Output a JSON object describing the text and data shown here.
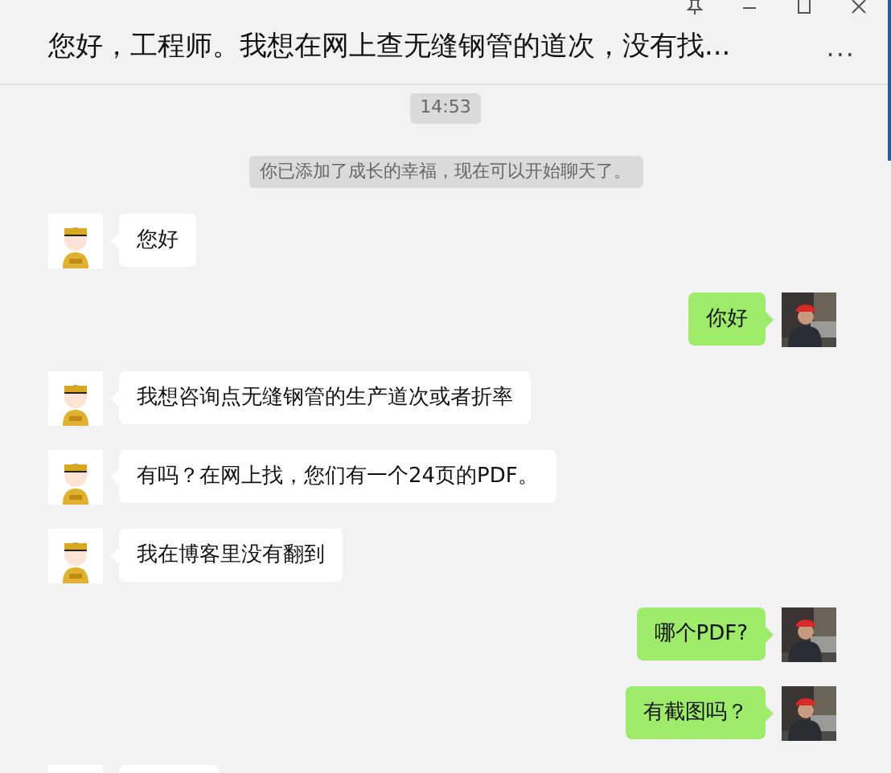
{
  "window": {
    "title": "您好，工程师。我想在网上查无缝钢管的道次，没有找...",
    "controls": [
      {
        "kind": "pin"
      },
      {
        "kind": "minimize"
      },
      {
        "kind": "maximize"
      },
      {
        "kind": "close"
      }
    ],
    "more": "..."
  },
  "time": "14:53",
  "system_notice": "你已添加了成长的幸福，现在可以开始聊天了。",
  "messages": [
    {
      "kind": "incoming",
      "text": "您好"
    },
    {
      "kind": "outgoing",
      "text": "你好"
    },
    {
      "kind": "incoming",
      "text": "我想咨询点无缝钢管的生产道次或者折率"
    },
    {
      "kind": "incoming",
      "text": "有吗？在网上找，您们有一个24页的PDF。"
    },
    {
      "kind": "incoming",
      "text": "我在博客里没有翻到"
    },
    {
      "kind": "outgoing",
      "text": "哪个PDF?"
    },
    {
      "kind": "outgoing",
      "text": "有截图吗？"
    },
    {
      "kind": "incoming"
    }
  ]
}
